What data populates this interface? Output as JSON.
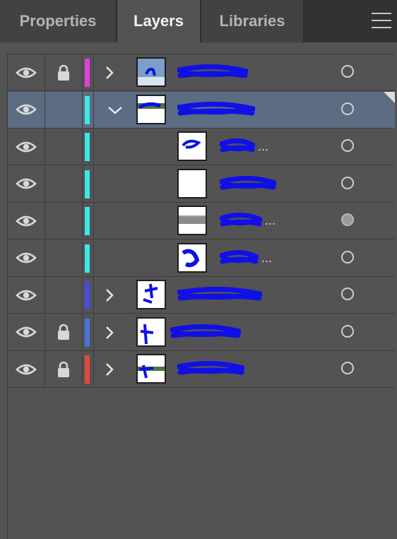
{
  "tabs": [
    {
      "label": "Properties",
      "active": false
    },
    {
      "label": "Layers",
      "active": true
    },
    {
      "label": "Libraries",
      "active": false
    }
  ],
  "menu_icon": "hamburger-menu-icon",
  "layers": [
    {
      "name": "",
      "color": "#e040e0",
      "locked": true,
      "expand": "collapsed",
      "level": 0,
      "selected": false,
      "target_filled": false
    },
    {
      "name": "",
      "color": "#3ee6e6",
      "locked": false,
      "expand": "expanded",
      "level": 0,
      "selected": true,
      "target_filled": false
    },
    {
      "name": "...",
      "color": "#3ee6e6",
      "locked": false,
      "expand": "none",
      "level": 1,
      "selected": false,
      "target_filled": false
    },
    {
      "name": "",
      "color": "#3ee6e6",
      "locked": false,
      "expand": "none",
      "level": 1,
      "selected": false,
      "target_filled": false
    },
    {
      "name": "...",
      "color": "#3ee6e6",
      "locked": false,
      "expand": "none",
      "level": 1,
      "selected": false,
      "target_filled": true
    },
    {
      "name": "...",
      "color": "#3ee6e6",
      "locked": false,
      "expand": "none",
      "level": 1,
      "selected": false,
      "target_filled": false
    },
    {
      "name": "",
      "color": "#4a4ae0",
      "locked": false,
      "expand": "collapsed",
      "level": 0,
      "selected": false,
      "target_filled": false
    },
    {
      "name": "",
      "color": "#4a72e0",
      "locked": true,
      "expand": "collapsed",
      "level": 0,
      "selected": false,
      "target_filled": false
    },
    {
      "name": "",
      "color": "#e04a3e",
      "locked": true,
      "expand": "collapsed",
      "level": 0,
      "selected": false,
      "target_filled": false
    }
  ],
  "icons": {
    "visibility": "eye-icon",
    "lock": "lock-icon",
    "collapsed": "chevron-right-icon",
    "expanded": "chevron-down-icon",
    "target": "target-circle-icon"
  }
}
